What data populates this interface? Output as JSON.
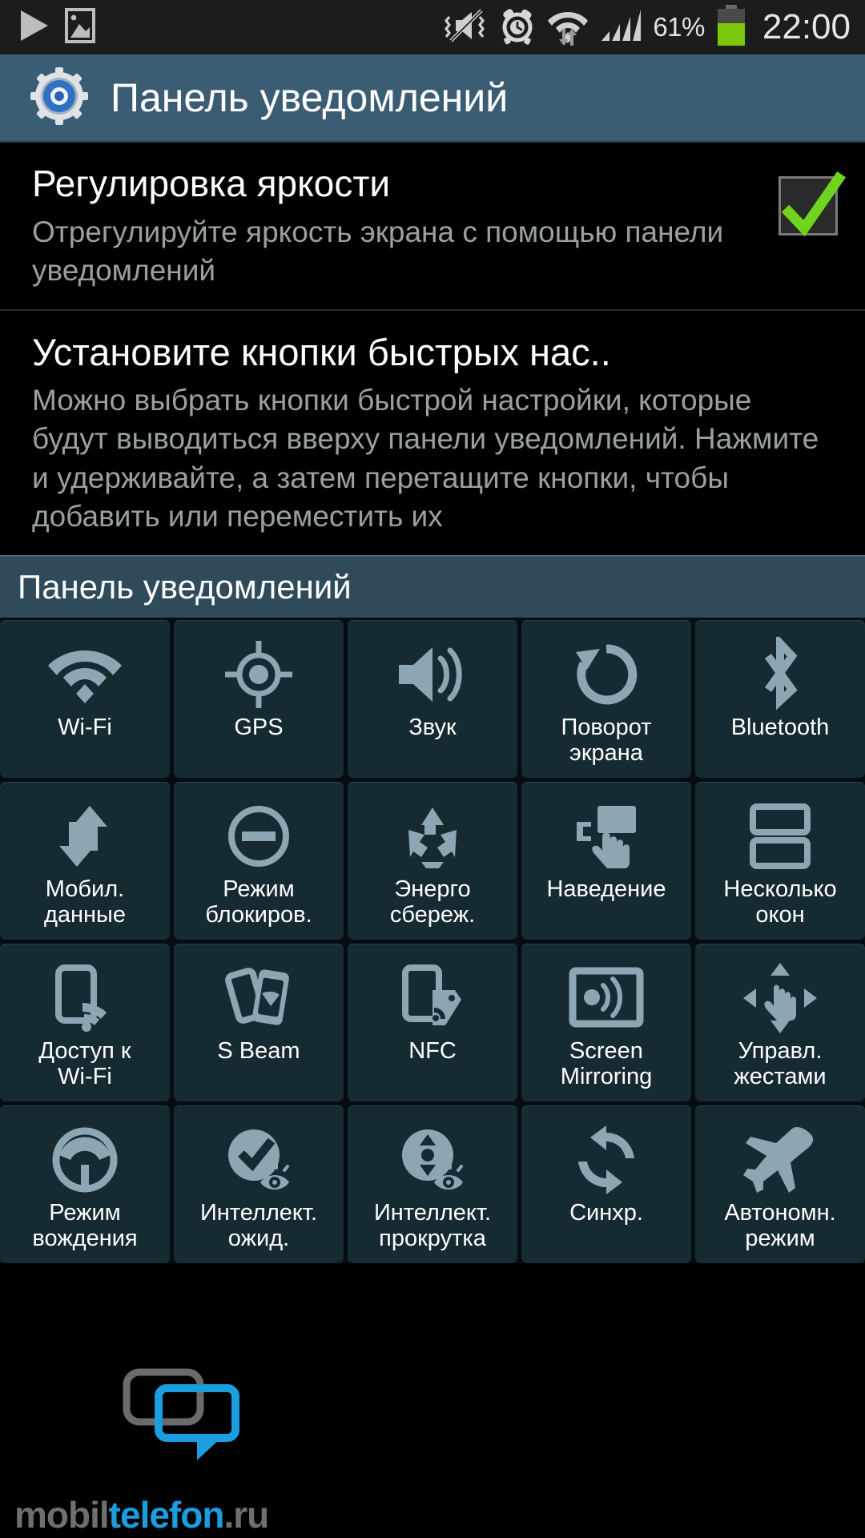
{
  "statusbar": {
    "icons_left": [
      "play-icon",
      "image-icon"
    ],
    "icons_right": [
      "vibrate-off-icon",
      "alarm-icon",
      "wifi-data-icon",
      "signal-bars-icon"
    ],
    "battery_percent": "61%",
    "battery_level": 61,
    "clock": "22:00"
  },
  "header": {
    "icon": "gear-icon",
    "title": "Панель уведомлений"
  },
  "settings": [
    {
      "title": "Регулировка яркости",
      "subtitle": "Отрегулируйте яркость экрана с помощью панели уведомлений",
      "checkbox": "checked",
      "check_color": "#6fd41b"
    },
    {
      "title": "Установите кнопки быстрых нас..",
      "subtitle": "Можно выбрать кнопки быстрой настройки, которые будут выводиться вверху панели уведомлений. Нажмите и удерживайте, а затем перетащите кнопки, чтобы добавить или переместить их",
      "checkbox": "none"
    }
  ],
  "section": {
    "title": "Панель уведомлений"
  },
  "tiles": [
    {
      "label": "Wi-Fi",
      "icon": "wifi-icon"
    },
    {
      "label": "GPS",
      "icon": "gps-icon"
    },
    {
      "label": "Звук",
      "icon": "sound-icon"
    },
    {
      "label": "Поворот\nэкрана",
      "icon": "screen-rotation-icon"
    },
    {
      "label": "Bluetooth",
      "icon": "bluetooth-icon"
    },
    {
      "label": "Мобил.\nданные",
      "icon": "mobile-data-icon"
    },
    {
      "label": "Режим\nблокиров.",
      "icon": "blocking-mode-icon"
    },
    {
      "label": "Энерго\nсбереж.",
      "icon": "power-saving-icon"
    },
    {
      "label": "Наведение",
      "icon": "air-view-icon"
    },
    {
      "label": "Несколько\nокон",
      "icon": "multi-window-icon"
    },
    {
      "label": "Доступ к\nWi-Fi",
      "icon": "wifi-hotspot-icon"
    },
    {
      "label": "S Beam",
      "icon": "s-beam-icon"
    },
    {
      "label": "NFC",
      "icon": "nfc-icon"
    },
    {
      "label": "Screen\nMirroring",
      "icon": "screen-mirroring-icon"
    },
    {
      "label": "Управл.\nжестами",
      "icon": "gesture-control-icon"
    },
    {
      "label": "Режим\nвождения",
      "icon": "driving-mode-icon"
    },
    {
      "label": "Интеллект.\nожид.",
      "icon": "smart-stay-icon"
    },
    {
      "label": "Интеллект.\nпрокрутка",
      "icon": "smart-scroll-icon"
    },
    {
      "label": "Синхр.",
      "icon": "sync-icon"
    },
    {
      "label": "Автономн.\nрежим",
      "icon": "airplane-mode-icon"
    }
  ],
  "watermark": {
    "text_a": "mobil",
    "text_b": "telefon",
    "text_c": ".ru"
  },
  "colors": {
    "titlebar": "#3b5d73",
    "tile_bg": "#162a32",
    "tile_icon": "#8ca6b2",
    "section_bg": "#2f4a59",
    "accent_green": "#6fd41b",
    "watermark_blue": "#1a9ee0"
  }
}
